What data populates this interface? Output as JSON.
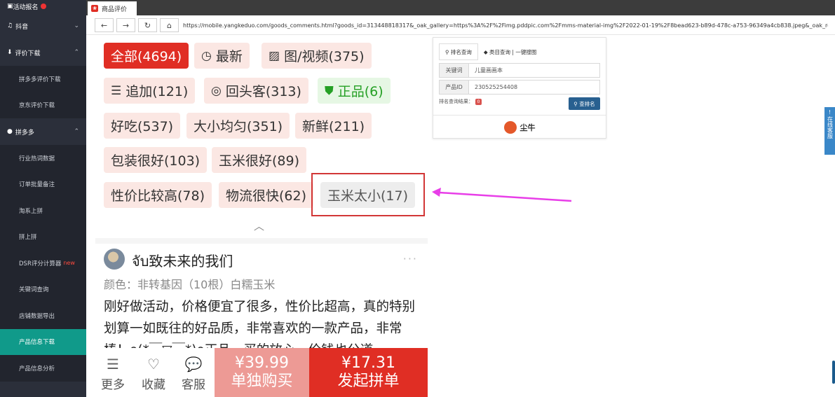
{
  "sidebar": {
    "top_item": "活动报名",
    "groups": [
      {
        "label": "抖音",
        "chevron": "⌄"
      },
      {
        "label": "评价下载",
        "chevron": "⌃"
      },
      {
        "label": "拼多多",
        "chevron": "⌃"
      }
    ],
    "review_items": [
      "拼多多评价下载",
      "京东评价下载"
    ],
    "pdd_items": [
      "行业热词数据",
      "订单批量备注",
      "淘系上拼",
      "拼上拼",
      "DSR评分计算器",
      "关键词查询",
      "店铺数据导出",
      "产品信息下载",
      "产品信息分析"
    ],
    "new_badge": "new"
  },
  "browser": {
    "tab_title": "商品评价",
    "url": "https://mobile.yangkeduo.com/goods_comments.html?goods_id=313448818317&_oak_gallery=https%3A%2F%2Fimg.pddpic.com%2Fmms-material-img%2F2022-01-19%2F8bead623-b89d-478c-a753-96349a4cb838.jpeg&_oak_re"
  },
  "filters": {
    "all": "全部(4694)",
    "latest": "最新",
    "media": "图/视频(375)",
    "append": "追加(121)",
    "repeat": "回头客(313)",
    "genuine": "正品(6)",
    "tasty": "好吃(537)",
    "size_even": "大小均匀(351)",
    "fresh": "新鲜(211)",
    "packaging": "包装很好(103)",
    "corn_good": "玉米很好(89)",
    "value": "性价比较高(78)",
    "logistics": "物流很快(62)",
    "corn_small": "玉米太小(17)"
  },
  "review": {
    "username": "จับ致未来的我们",
    "spec": "颜色：非转基因（10根）白糯玉米",
    "text": "刚好做活动，价格便宜了很多，性价比超高，真的特别划算一如既往的好品质，非常喜欢的一款产品，非常棒！o(*￣▽￣*)o正品，买的放心，价钱也公道"
  },
  "bottom_bar": {
    "more": "更多",
    "favorite": "收藏",
    "service": "客服",
    "single_price": "¥39.99",
    "single_label": "单独购买",
    "group_price": "¥17.31",
    "group_label": "发起拼单"
  },
  "panel": {
    "tab1": "排名查询",
    "tab2": "类目查询 | 一键搜图",
    "keyword_label": "关键词",
    "keyword_value": "儿童画画本",
    "product_label": "产品ID",
    "product_value": "230525254408",
    "result_label": "排名查询结果：",
    "rank_button": "查排名",
    "brand": "尘牛"
  },
  "float_service": "在线客服",
  "colors": {
    "sidebar_bg": "#2b2f3a",
    "active_item": "#109a8a",
    "pdd_red": "#e02e24",
    "arrow": "#e83ee8",
    "highlight_box": "#d23636"
  }
}
